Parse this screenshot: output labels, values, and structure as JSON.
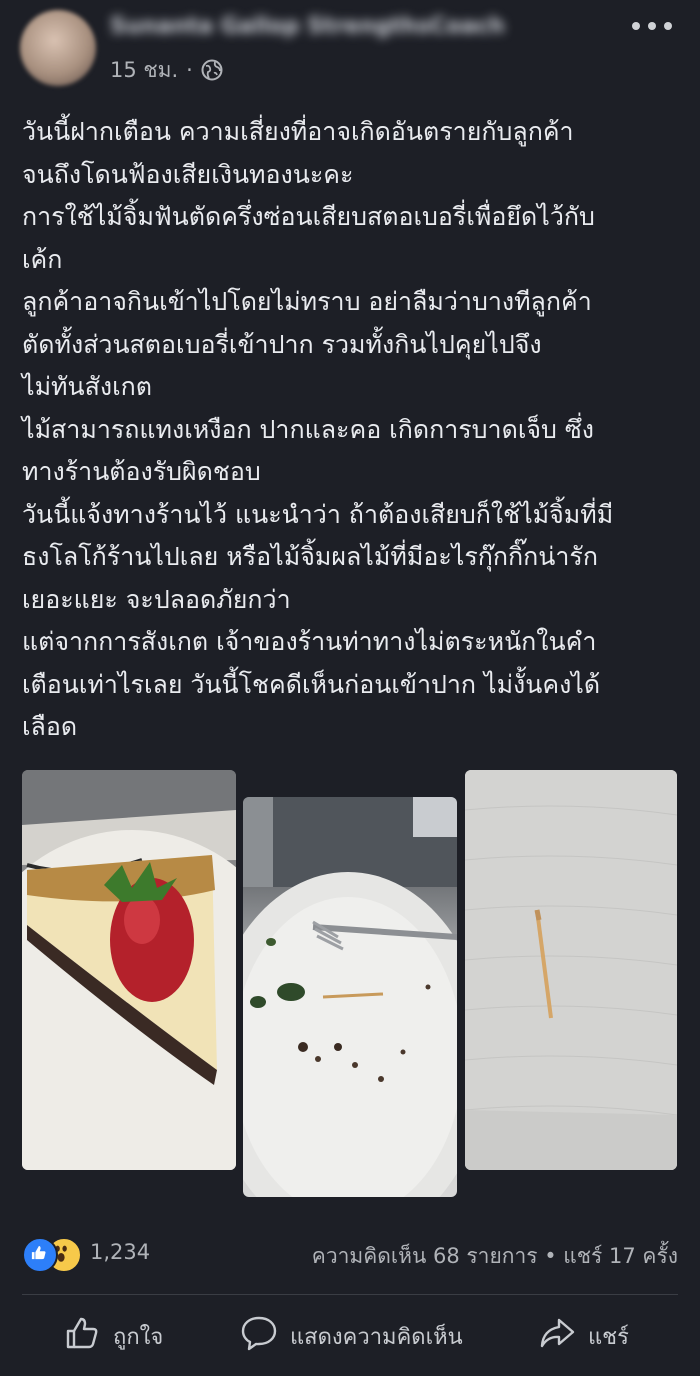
{
  "header": {
    "author_name": "Sunanta Gallop StrengthsCoach",
    "timestamp": "15 ชม.",
    "separator": "·",
    "privacy_icon": "globe-icon",
    "more_icon": "more-dots-icon"
  },
  "post": {
    "lines": [
      "วันนี้ฝากเตือน ความเสี่ยงที่อาจเกิดอันตรายกับลูกค้า",
      "จนถึงโดนฟ้องเสียเงินทองนะคะ",
      "การใช้ไม้จิ้มฟันตัดครึ่งซ่อนเสียบสตอเบอรี่เพื่อยึดไว้กับ",
      "เค้ก",
      "ลูกค้าอาจกินเข้าไปโดยไม่ทราบ อย่าลืมว่าบางทีลูกค้า",
      "ตัดทั้งส่วนสตอเบอรี่เข้าปาก รวมทั้งกินไปคุยไปจึง",
      "ไม่ทันสังเกต",
      "ไม้สามารถแทงเหงือก ปากและคอ เกิดการบาดเจ็บ ซึ่ง",
      "ทางร้านต้องรับผิดชอบ",
      "วันนี้แจ้งทางร้านไว้ แนะนำว่า ถ้าต้องเสียบก็ใช้ไม้จิ้มที่มี",
      "ธงโลโก้ร้านไปเลย หรือไม้จิ้มผลไม้ที่มีอะไรกุ๊กกิ๊กน่ารัก",
      "เยอะแยะ  จะปลอดภัยกว่า",
      "แต่จากการสังเกต เจ้าของร้านท่าทางไม่ตระหนักในคำ",
      "เตือนเท่าไรเลย  วันนี้โชคดีเห็นก่อนเข้าปาก ไม่งั้นคงได้",
      "เลือด"
    ]
  },
  "photos": [
    {
      "icon": "cheesecake-photo"
    },
    {
      "icon": "empty-plate-photo"
    },
    {
      "icon": "toothpick-napkin-photo"
    }
  ],
  "reactions": {
    "icons": [
      "like-react-icon",
      "wow-react-icon"
    ],
    "count": "1,234",
    "stats": "ความคิดเห็น 68 รายการ • แชร์ 17 ครั้ง"
  },
  "actions": {
    "like_label": "ถูกใจ",
    "comment_label": "แสดงความคิดเห็น",
    "share_label": "แชร์"
  },
  "colors": {
    "background": "#1d1f26",
    "text": "#e9ebef",
    "secondary_text": "#b0b3b8",
    "like_blue": "#2d7ff9",
    "wow_yellow": "#f7c94a"
  }
}
